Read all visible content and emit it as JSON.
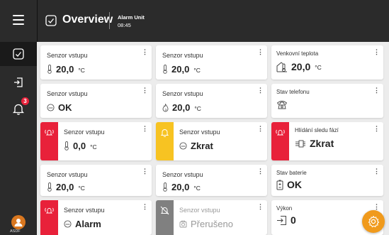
{
  "header": {
    "title": "Overview",
    "unit_name": "Alarm Unit",
    "time": "08:45"
  },
  "sidebar": {
    "items": [
      {
        "icon": "overview-icon",
        "active": true
      },
      {
        "icon": "logout-door-icon",
        "active": false
      },
      {
        "icon": "bell-icon",
        "active": false,
        "badge": "3"
      }
    ],
    "avatar_label": "ASDF"
  },
  "colors": {
    "alarm_red": "#e8213a",
    "warning_yellow": "#f7c322",
    "offline_grey": "#808080",
    "accent_orange": "#f09a1c",
    "topbar": "#2b2b2b"
  },
  "cards": [
    {
      "id": "c1",
      "label": "Senzor vstupu",
      "value": "20,0",
      "unit": "°C",
      "icon": "thermometer-icon"
    },
    {
      "id": "c2",
      "label": "Senzor vstupu",
      "value": "20,0",
      "unit": "°C",
      "icon": "thermometer-icon"
    },
    {
      "id": "c3",
      "label": "Senzor vstupu",
      "value": "OK",
      "icon": "contact-ok-icon"
    },
    {
      "id": "c4",
      "label": "Senzor vstupu",
      "value": "20,0",
      "unit": "°C",
      "icon": "flame-icon"
    },
    {
      "id": "c5",
      "label": "Senzor vstupu",
      "value": "0,0",
      "unit": "°C",
      "icon": "thermometer-icon",
      "status": "alarm"
    },
    {
      "id": "c6",
      "label": "Senzor vstupu",
      "value": "Zkrat",
      "icon": "contact-ok-icon",
      "status": "warning"
    },
    {
      "id": "c7",
      "label": "Senzor vstupu",
      "value": "20,0",
      "unit": "°C",
      "icon": "thermometer-icon"
    },
    {
      "id": "c8",
      "label": "Senzor vstupu",
      "value": "20,0",
      "unit": "°C",
      "icon": "thermometer-icon"
    },
    {
      "id": "c9",
      "label": "Senzor vstupu",
      "value": "Alarm",
      "icon": "contact-ok-icon",
      "status": "alarm"
    },
    {
      "id": "c10",
      "label": "Senzor vstupu",
      "value": "Přerušeno",
      "icon": "camera-icon",
      "status": "offline"
    }
  ],
  "right_cards": [
    {
      "id": "r1",
      "label": "Venkovní teplota",
      "value": "20,0",
      "unit": "°C",
      "icon": "outdoor-thermometer-icon"
    },
    {
      "id": "r2",
      "label": "Stav telefonu",
      "value": "",
      "icon": "phone-icon"
    },
    {
      "id": "r3",
      "label": "Hlídání sledu fází",
      "value": "Zkrat",
      "icon": "phase-sequence-icon",
      "status": "alarm"
    },
    {
      "id": "r4",
      "label": "Stav baterie",
      "value": "OK",
      "icon": "battery-icon"
    },
    {
      "id": "r5",
      "label": "Výkon",
      "value": "0",
      "icon": "power-input-icon"
    }
  ]
}
